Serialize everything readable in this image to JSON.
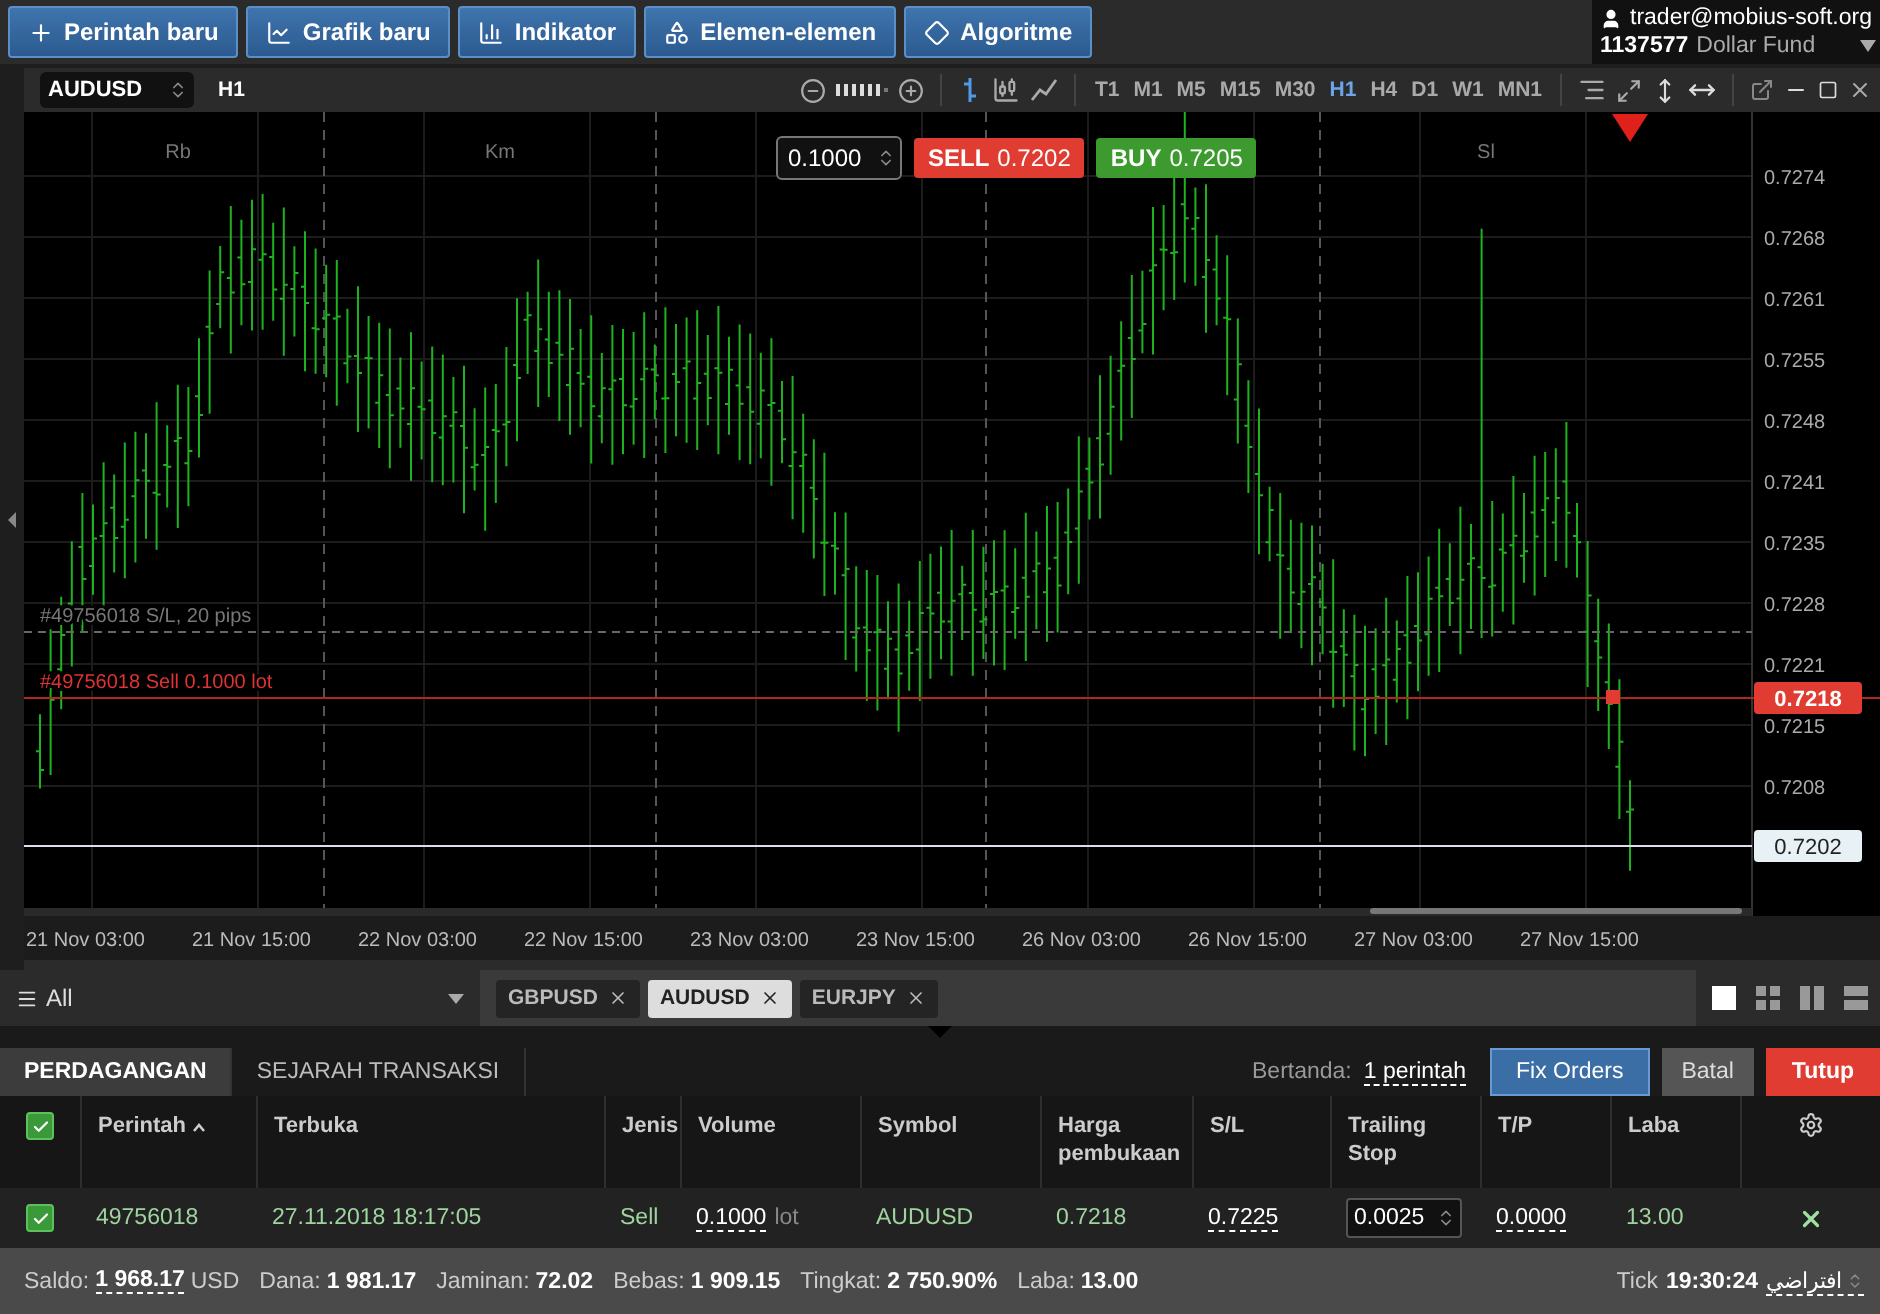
{
  "toolbar": {
    "buttons": [
      {
        "label": "Perintah baru",
        "kind": "plus"
      },
      {
        "label": "Grafik baru",
        "kind": "chart"
      },
      {
        "label": "Indikator",
        "kind": "bars"
      },
      {
        "label": "Elemen-elemen",
        "kind": "shapes"
      },
      {
        "label": "Algoritme",
        "kind": "diamond"
      }
    ]
  },
  "account": {
    "email": "trader@mobius-soft.org",
    "number": "1137577",
    "name": "Dollar Fund"
  },
  "chart": {
    "symbol": "AUDUSD",
    "timeframe": "H1",
    "zoom": {
      "level": 0.85
    },
    "chart_types": [
      {
        "kind": "bars",
        "selected": true
      },
      {
        "kind": "candles",
        "selected": false
      },
      {
        "kind": "line",
        "selected": false
      }
    ],
    "timeframes": [
      {
        "label": "T1",
        "selected": false
      },
      {
        "label": "M1",
        "selected": false
      },
      {
        "label": "M5",
        "selected": false
      },
      {
        "label": "M15",
        "selected": false
      },
      {
        "label": "M30",
        "selected": false
      },
      {
        "label": "H1",
        "selected": true
      },
      {
        "label": "H4",
        "selected": false
      },
      {
        "label": "D1",
        "selected": false
      },
      {
        "label": "W1",
        "selected": false
      },
      {
        "label": "MN1",
        "selected": false
      }
    ],
    "sessions": [
      "Rb",
      "Km",
      "Sl"
    ],
    "order_panel": {
      "volume": "0.1000",
      "sell_label": "SELL",
      "sell_price": "0.7202",
      "buy_label": "BUY",
      "buy_price": "0.7205"
    },
    "price_labels": [
      "0.7274",
      "0.7268",
      "0.7261",
      "0.7255",
      "0.7248",
      "0.7241",
      "0.7235",
      "0.7228",
      "0.7221",
      "0.7215",
      "0.7208"
    ],
    "time_labels": [
      "21 Nov 03:00",
      "21 Nov 15:00",
      "22 Nov 03:00",
      "22 Nov 15:00",
      "23 Nov 03:00",
      "23 Nov 15:00",
      "26 Nov 03:00",
      "26 Nov 15:00",
      "27 Nov 03:00",
      "27 Nov 15:00"
    ],
    "stop_line": {
      "label": "#49756018 S/L, 20 pips"
    },
    "order_line": {
      "label": "#49756018 Sell 0.1000 lot",
      "price": "0.7218"
    },
    "bid_line": {
      "price": "0.7202"
    }
  },
  "chart_tabs": {
    "filter": "All",
    "tabs": [
      {
        "label": "GBPUSD",
        "selected": false
      },
      {
        "label": "AUDUSD",
        "selected": true
      },
      {
        "label": "EURJPY",
        "selected": false
      }
    ],
    "layouts": [
      {
        "kind": "single",
        "selected": true
      },
      {
        "kind": "grid",
        "selected": false
      },
      {
        "kind": "columns",
        "selected": false
      },
      {
        "kind": "rows",
        "selected": false
      }
    ]
  },
  "panel": {
    "tabs": [
      {
        "label": "PERDAGANGAN",
        "selected": true
      },
      {
        "label": "SEJARAH TRANSAKSI",
        "selected": false
      }
    ],
    "marked_label": "Bertanda:",
    "marked_link": "1 perintah",
    "buttons": [
      {
        "label": "Fix Orders",
        "kind": "primary"
      },
      {
        "label": "Batal",
        "kind": "secondary"
      },
      {
        "label": "Tutup",
        "kind": "danger"
      }
    ]
  },
  "table": {
    "all_checked": true,
    "columns": [
      {
        "label": "Perintah",
        "sorted": true
      },
      {
        "label": "Terbuka",
        "sorted": false
      },
      {
        "label": "Jenis",
        "sorted": false
      },
      {
        "label": "Volume",
        "sorted": false
      },
      {
        "label": "Symbol",
        "sorted": false
      },
      {
        "label": "Harga pembukaan",
        "sorted": false
      },
      {
        "label": "S/L",
        "sorted": false
      },
      {
        "label": "Trailing Stop",
        "sorted": false
      },
      {
        "label": "T/P",
        "sorted": false
      },
      {
        "label": "Laba",
        "sorted": false
      }
    ],
    "rows": [
      {
        "checked": true,
        "cells": [
          {
            "value": "49756018",
            "kind": "text"
          },
          {
            "value": "27.11.2018 18:17:05",
            "kind": "text"
          },
          {
            "value": "Sell",
            "kind": "text"
          },
          {
            "value": "0.1000",
            "kind": "editable",
            "unit": "lot"
          },
          {
            "value": "AUDUSD",
            "kind": "text"
          },
          {
            "value": "0.7218",
            "kind": "text"
          },
          {
            "value": "0.7225",
            "kind": "editable"
          },
          {
            "value": "0.0025",
            "kind": "input"
          },
          {
            "value": "0.0000",
            "kind": "editable"
          },
          {
            "value": "13.00",
            "kind": "text"
          }
        ]
      }
    ]
  },
  "status": {
    "items": [
      {
        "label": "Saldo:",
        "value": "1 968.17",
        "unit": "USD",
        "editable": true
      },
      {
        "label": "Dana:",
        "value": "1 981.17",
        "editable": false
      },
      {
        "label": "Jaminan:",
        "value": "72.02",
        "editable": false
      },
      {
        "label": "Bebas:",
        "value": "1 909.15",
        "editable": false
      },
      {
        "label": "Tingkat:",
        "value": "2 750.90%",
        "editable": false
      },
      {
        "label": "Laba:",
        "value": "13.00",
        "editable": false
      }
    ],
    "tick_label": "Tick",
    "tick_time": "19:30:24",
    "mode": "افتراضي"
  }
}
